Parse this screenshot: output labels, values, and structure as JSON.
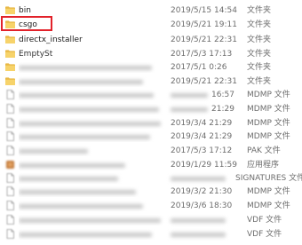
{
  "files": [
    {
      "name": "bin",
      "date": "2019/5/15 14:54",
      "type": "文件夹",
      "icon": "folder-icon",
      "blur": false
    },
    {
      "name": "csgo",
      "date": "2019/5/21 19:11",
      "type": "文件夹",
      "icon": "folder-icon",
      "blur": false,
      "highlighted": true
    },
    {
      "name": "directx_installer",
      "date": "2019/5/21 22:31",
      "type": "文件夹",
      "icon": "folder-icon",
      "blur": false
    },
    {
      "name": "EmptySt",
      "date": "2017/5/3 17:13",
      "type": "文件夹",
      "icon": "folder-icon",
      "blur": "partial"
    },
    {
      "name": "",
      "date": "2017/5/1 0:26",
      "type": "文件夹",
      "icon": "folder-icon",
      "blur": true
    },
    {
      "name": "",
      "date": "2019/5/21 22:31",
      "type": "文件夹",
      "icon": "folder-icon",
      "blur": true
    },
    {
      "name": "",
      "date": "16:57",
      "type": "MDMP 文件",
      "icon": "file-icon",
      "blur": true
    },
    {
      "name": "",
      "date": "21:29",
      "type": "MDMP 文件",
      "icon": "file-icon",
      "blur": true
    },
    {
      "name": "",
      "date": "2019/3/4 21:29",
      "type": "MDMP 文件",
      "icon": "file-icon",
      "blur": true
    },
    {
      "name": "",
      "date": "2019/3/4 21:29",
      "type": "MDMP 文件",
      "icon": "file-icon",
      "blur": true
    },
    {
      "name": "",
      "date": "2017/5/3 17:12",
      "type": "PAK 文件",
      "icon": "file-icon",
      "blur": true
    },
    {
      "name": "",
      "date": "2019/1/29 11:59",
      "type": "应用程序",
      "icon": "app-icon",
      "blur": true
    },
    {
      "name": "",
      "date": "",
      "type": "SIGNATURES 文件",
      "icon": "file-icon",
      "blur": true
    },
    {
      "name": "",
      "date": "2019/3/2 21:30",
      "type": "MDMP 文件",
      "icon": "file-icon",
      "blur": true
    },
    {
      "name": "",
      "date": "2019/3/6 18:30",
      "type": "MDMP 文件",
      "icon": "file-icon",
      "blur": true
    },
    {
      "name": "",
      "date": "",
      "type": "VDF 文件",
      "icon": "file-icon",
      "blur": true
    },
    {
      "name": "",
      "date": "",
      "type": "VDF 文件",
      "icon": "file-icon",
      "blur": true
    }
  ]
}
